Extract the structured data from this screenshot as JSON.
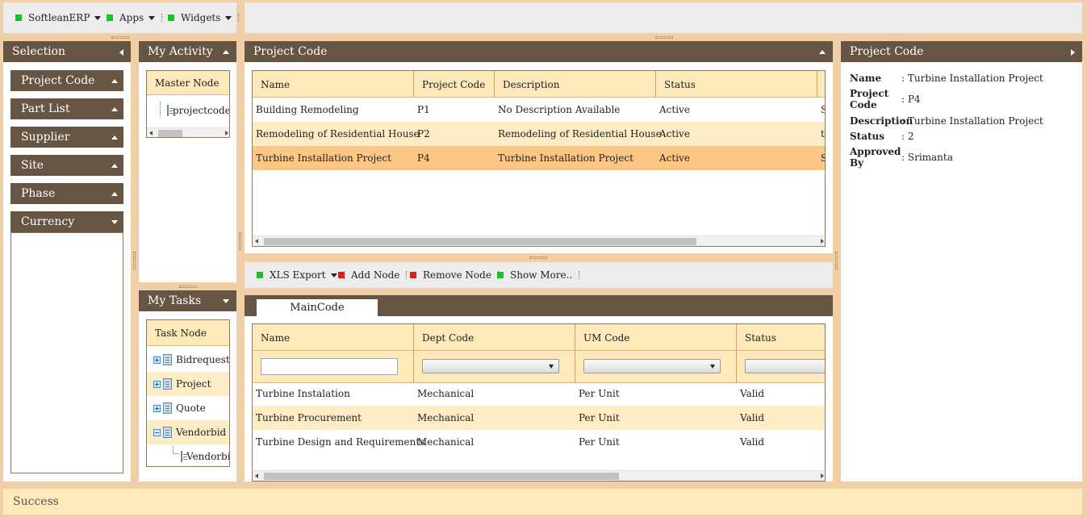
{
  "top_menu": [
    {
      "label": "SoftleanERP"
    },
    {
      "label": "Apps"
    },
    {
      "label": "Widgets"
    }
  ],
  "selection": {
    "title": "Selection",
    "items": [
      {
        "label": "Project Code",
        "state": "collapsed-up"
      },
      {
        "label": "Part List",
        "state": "collapsed-up"
      },
      {
        "label": "Supplier",
        "state": "collapsed-up"
      },
      {
        "label": "Site",
        "state": "collapsed-up"
      },
      {
        "label": "Phase",
        "state": "collapsed-up"
      },
      {
        "label": "Currency",
        "state": "expanded-down"
      }
    ]
  },
  "my_activity": {
    "title": "My Activity",
    "column": "Master Node",
    "nodes": [
      {
        "label": "projectcode"
      }
    ]
  },
  "my_tasks": {
    "title": "My Tasks",
    "column": "Task Node",
    "nodes": [
      {
        "label": "Bidrequest"
      },
      {
        "label": "Project"
      },
      {
        "label": "Quote"
      },
      {
        "label": "Vendorbid"
      },
      {
        "label": "Vendorbid"
      }
    ]
  },
  "project_grid": {
    "title": "Project Code",
    "columns": [
      "Name",
      "Project Code",
      "Description",
      "Status"
    ],
    "rows": [
      {
        "name": "Building Remodeling",
        "code": "P1",
        "description": "No Description Available",
        "status": "Active",
        "extra": "S"
      },
      {
        "name": "Remodeling of Residential House",
        "code": "P2",
        "description": "Remodeling of Residential House",
        "status": "Active",
        "extra": "t"
      },
      {
        "name": "Turbine Installation Project",
        "code": "P4",
        "description": "Turbine Installation Project",
        "status": "Active",
        "extra": "S"
      }
    ]
  },
  "toolbar": {
    "xls_export": "XLS Export",
    "add_node": "Add Node",
    "remove_node": "Remove Node",
    "show_more": "Show More.."
  },
  "main_code": {
    "tab": "MainCode",
    "columns": [
      "Name",
      "Dept Code",
      "UM Code",
      "Status"
    ],
    "filter_name_value": "",
    "rows": [
      {
        "name": "Turbine Instalation",
        "dept": "Mechanical",
        "um": "Per Unit",
        "status": "Valid"
      },
      {
        "name": "Turbine Procurement",
        "dept": "Mechanical",
        "um": "Per Unit",
        "status": "Valid"
      },
      {
        "name": "Turbine Design and Requirements",
        "dept": "Mechanical",
        "um": "Per Unit",
        "status": "Valid"
      }
    ]
  },
  "detail": {
    "title": "Project Code",
    "name_label": "Name",
    "name_value": ": Turbine Installation Project",
    "code_label_1": "Project",
    "code_label_2": "Code",
    "code_value": ": P4",
    "description_label": "Description",
    "description_value": ": Turbine Installation Project",
    "status_label": "Status",
    "status_value": ": 2",
    "approved_label_1": "Approved",
    "approved_label_2": "By",
    "approved_value": ": Srimanta"
  },
  "status_bar": {
    "message": "Success"
  },
  "colors": {
    "header": "#665543",
    "accent": "#fde9b9",
    "selected_row": "#fcc685",
    "background": "#f1cfa6"
  }
}
